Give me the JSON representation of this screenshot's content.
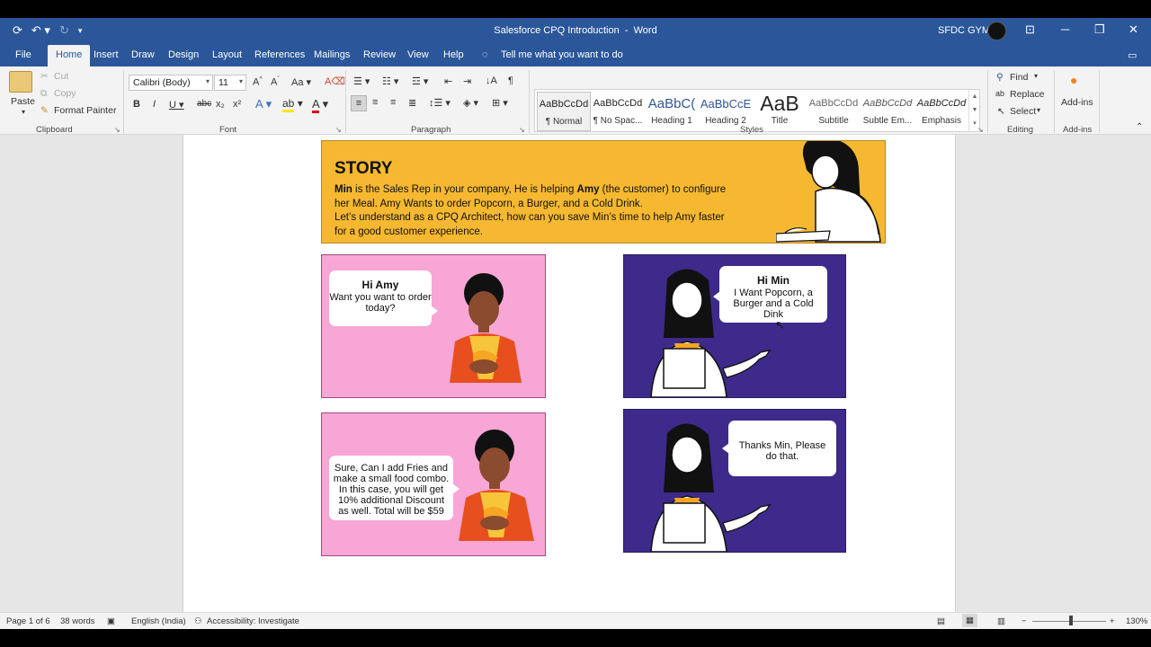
{
  "window": {
    "title": "Salesforce CPQ Introduction",
    "app_name": "Word",
    "separator": "-",
    "user_name": "SFDC GYM"
  },
  "tabs": [
    "File",
    "Home",
    "Insert",
    "Draw",
    "Design",
    "Layout",
    "References",
    "Mailings",
    "Review",
    "View",
    "Help"
  ],
  "tell_me": "Tell me what you want to do",
  "clipboard": {
    "paste": "Paste",
    "cut": "Cut",
    "copy": "Copy",
    "format_painter": "Format Painter",
    "label": "Clipboard"
  },
  "font": {
    "name": "Calibri (Body)",
    "size": "11",
    "label": "Font"
  },
  "paragraph": {
    "label": "Paragraph"
  },
  "styles": {
    "label": "Styles",
    "items": [
      {
        "preview": "AaBbCcDd",
        "name": "¶ Normal"
      },
      {
        "preview": "AaBbCcDd",
        "name": "¶ No Spac..."
      },
      {
        "preview": "AaBbC(",
        "name": "Heading 1"
      },
      {
        "preview": "AaBbCcE",
        "name": "Heading 2"
      },
      {
        "preview": "AaB",
        "name": "Title"
      },
      {
        "preview": "AaBbCcDd",
        "name": "Subtitle"
      },
      {
        "preview": "AaBbCcDd",
        "name": "Subtle Em..."
      },
      {
        "preview": "AaBbCcDd",
        "name": "Emphasis"
      }
    ]
  },
  "editing": {
    "find": "Find",
    "replace": "Replace",
    "select": "Select",
    "label": "Editing"
  },
  "addins": {
    "button": "Add-ins",
    "label": "Add-ins"
  },
  "document": {
    "story_title": "STORY",
    "story_lines": [
      [
        {
          "t": "Min",
          "b": true
        },
        {
          "t": " is the Sales Rep in your company, He is helping "
        },
        {
          "t": "Amy",
          "b": true
        },
        {
          "t": " (the customer) to configure"
        }
      ],
      [
        {
          "t": "her Meal. Amy Wants to order Popcorn, a Burger, and a Cold Drink."
        }
      ],
      [
        {
          "t": "Let’s understand as a CPQ Architect, how can you save Min’s time to help Amy faster"
        }
      ],
      [
        {
          "t": "for a good customer experience."
        }
      ]
    ],
    "panel1": {
      "title": "Hi Amy",
      "text": "Want you want to order today?"
    },
    "panel2": {
      "title": "Hi Min",
      "text": "I Want Popcorn, a Burger and a Cold Dink"
    },
    "panel3": {
      "text": "Sure, Can I add Fries and make a small food combo. In this case, you will get 10% additional Discount as well. Total will be $59"
    },
    "panel4": {
      "text": "Thanks Min, Please do that."
    }
  },
  "status": {
    "page": "Page 1 of 6",
    "words": "38 words",
    "language": "English (India)",
    "accessibility": "Accessibility: Investigate",
    "zoom": "130%"
  },
  "colors": {
    "word_blue": "#2b579a",
    "story_bg": "#f5b830",
    "pink_panel": "#f7a6d6",
    "purple_panel": "#3d2a8a",
    "accent_orange": "#f5a623"
  }
}
